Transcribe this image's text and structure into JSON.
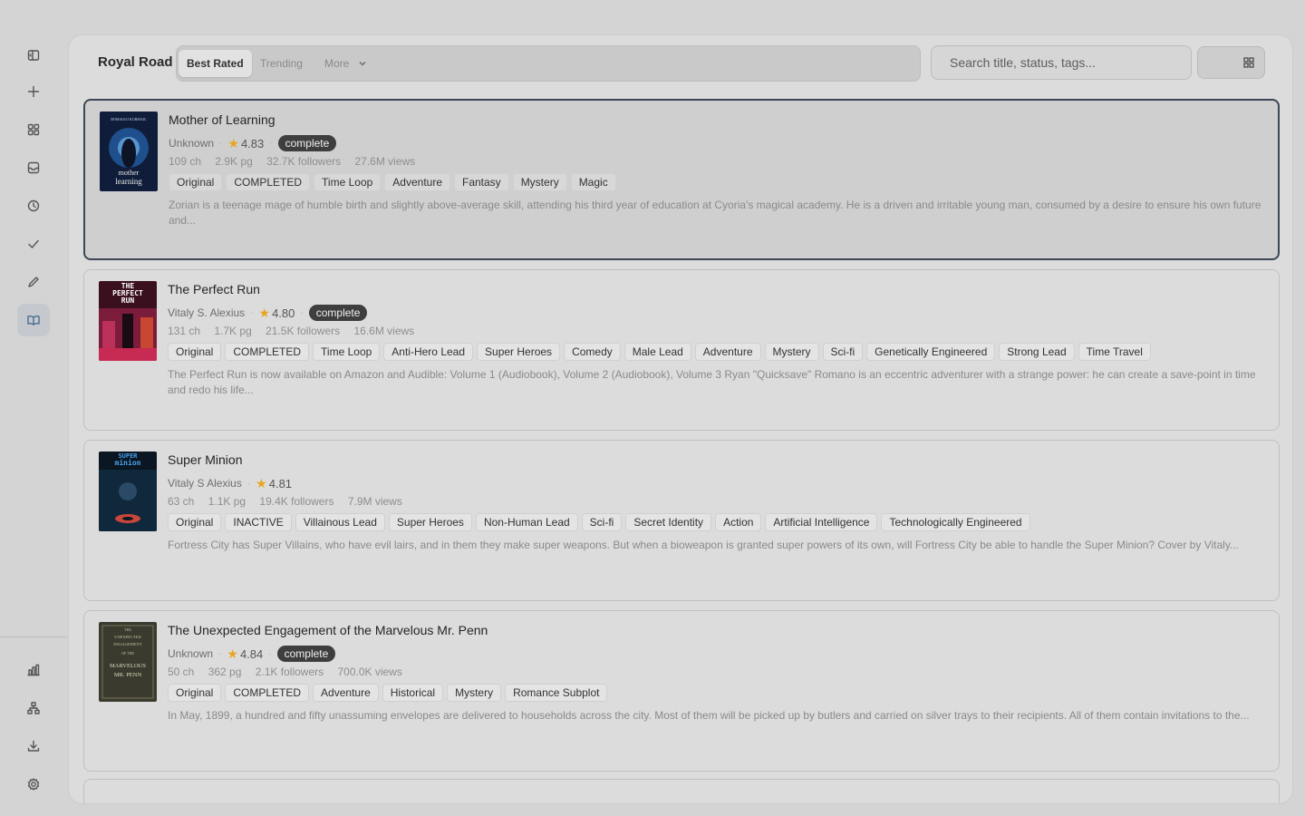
{
  "app": {
    "brand": "Royal Road",
    "tabs": [
      {
        "label": "Best Rated",
        "active": true
      },
      {
        "label": "Trending",
        "active": false
      },
      {
        "label": "More",
        "active": false
      }
    ],
    "search_placeholder": "Search title, status, tags...",
    "view_mode": "list"
  },
  "rail": {
    "top_items": [
      "panel-toggle-icon",
      "plus-icon",
      "grid-icon",
      "inbox-icon",
      "clock-icon",
      "check-icon",
      "pencil-icon",
      "book-icon"
    ],
    "active_item": "book-icon",
    "bottom_items": [
      "bar-chart-icon",
      "hierarchy-icon",
      "download-icon",
      "gear-icon"
    ]
  },
  "colors": {
    "accent_star": "#e9a51f",
    "badge_bg": "#3e3e3e",
    "selected_border": "#3c4654"
  },
  "books": [
    {
      "title": "Mother of Learning",
      "author": "Unknown",
      "rating": "4.83",
      "status_badge": "complete",
      "chapters": "109 ch",
      "pages": "2.9K pg",
      "followers": "32.7K followers",
      "views": "27.6M views",
      "tags": [
        "Original",
        "COMPLETED",
        "Time Loop",
        "Adventure",
        "Fantasy",
        "Mystery",
        "Magic"
      ],
      "description": "Zorian is a teenage mage of humble birth and slightly above-average skill, attending his third year of education at Cyoria's magical academy. He is a driven and irritable young man, consumed by a desire to ensure his own future and...",
      "cover_text": [
        "mother",
        "learning"
      ],
      "cover_top_text": "DOMAGOJ KURMAIC"
    },
    {
      "title": "The Perfect Run",
      "author": "Vitaly S. Alexius",
      "rating": "4.80",
      "status_badge": "complete",
      "chapters": "131 ch",
      "pages": "1.7K pg",
      "followers": "21.5K followers",
      "views": "16.6M views",
      "tags": [
        "Original",
        "COMPLETED",
        "Time Loop",
        "Anti-Hero Lead",
        "Super Heroes",
        "Comedy",
        "Male Lead",
        "Adventure",
        "Mystery",
        "Sci-fi",
        "Genetically Engineered",
        "Strong Lead",
        "Time Travel"
      ],
      "description": "The Perfect Run is now available on Amazon and Audible: Volume 1 (Audiobook), Volume 2 (Audiobook), Volume 3 Ryan \"Quicksave\" Romano is an eccentric adventurer with a strange power: he can create a save-point in time and redo his life...",
      "cover_text": [
        "THE",
        "PERFECT",
        "RUN"
      ]
    },
    {
      "title": "Super Minion",
      "author": "Vitaly S Alexius",
      "rating": "4.81",
      "status_badge": "",
      "chapters": "63 ch",
      "pages": "1.1K pg",
      "followers": "19.4K followers",
      "views": "7.9M views",
      "tags": [
        "Original",
        "INACTIVE",
        "Villainous Lead",
        "Super Heroes",
        "Non-Human Lead",
        "Sci-fi",
        "Secret Identity",
        "Action",
        "Artificial Intelligence",
        "Technologically Engineered"
      ],
      "description": "Fortress City has Super Villains, who have evil lairs, and in them they make super weapons. But when a bioweapon is granted super powers of its own, will Fortress City be able to handle the Super Minion? Cover by Vitaly...",
      "cover_text": [
        "SUPER",
        "minion"
      ]
    },
    {
      "title": "The Unexpected Engagement of the Marvelous Mr. Penn",
      "author": "Unknown",
      "rating": "4.84",
      "status_badge": "complete",
      "chapters": "50 ch",
      "pages": "362 pg",
      "followers": "2.1K followers",
      "views": "700.0K views",
      "tags": [
        "Original",
        "COMPLETED",
        "Adventure",
        "Historical",
        "Mystery",
        "Romance Subplot"
      ],
      "description": "In May, 1899, a hundred and fifty unassuming envelopes are delivered to households across the city. Most of them will be picked up by butlers and carried on silver trays to their recipients. All of them contain invitations to the...",
      "cover_text": [
        "THE",
        "UNEXPECTED",
        "ENGAGEMENT",
        "OF THE",
        "MARVELOUS",
        "MR. PENN"
      ]
    }
  ]
}
